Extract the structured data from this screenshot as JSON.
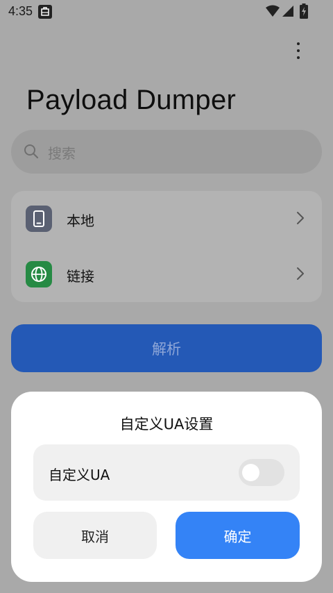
{
  "status_bar": {
    "time": "4:35",
    "notification_icon": "screenshot-notification-icon",
    "wifi_icon": "wifi-icon",
    "signal_icon": "cell-signal-icon",
    "battery_icon": "battery-charging-icon"
  },
  "app": {
    "title": "Payload Dumper",
    "menu_icon": "more-vertical-icon",
    "search": {
      "placeholder": "搜索",
      "icon": "search-icon"
    },
    "sources": [
      {
        "label": "本地",
        "icon": "phone-icon"
      },
      {
        "label": "链接",
        "icon": "globe-icon"
      }
    ],
    "parse_button": "解析"
  },
  "dialog": {
    "title": "自定义UA设置",
    "ua_switch_label": "自定义UA",
    "ua_switch_on": false,
    "cancel_label": "取消",
    "confirm_label": "确定"
  },
  "colors": {
    "scrim_background": "#a9a9a9",
    "primary_blue": "#3483f6",
    "parse_button_dimmed": "#2459b6",
    "phone_icon_bg": "#5a6072",
    "globe_icon_bg": "#268a44"
  }
}
